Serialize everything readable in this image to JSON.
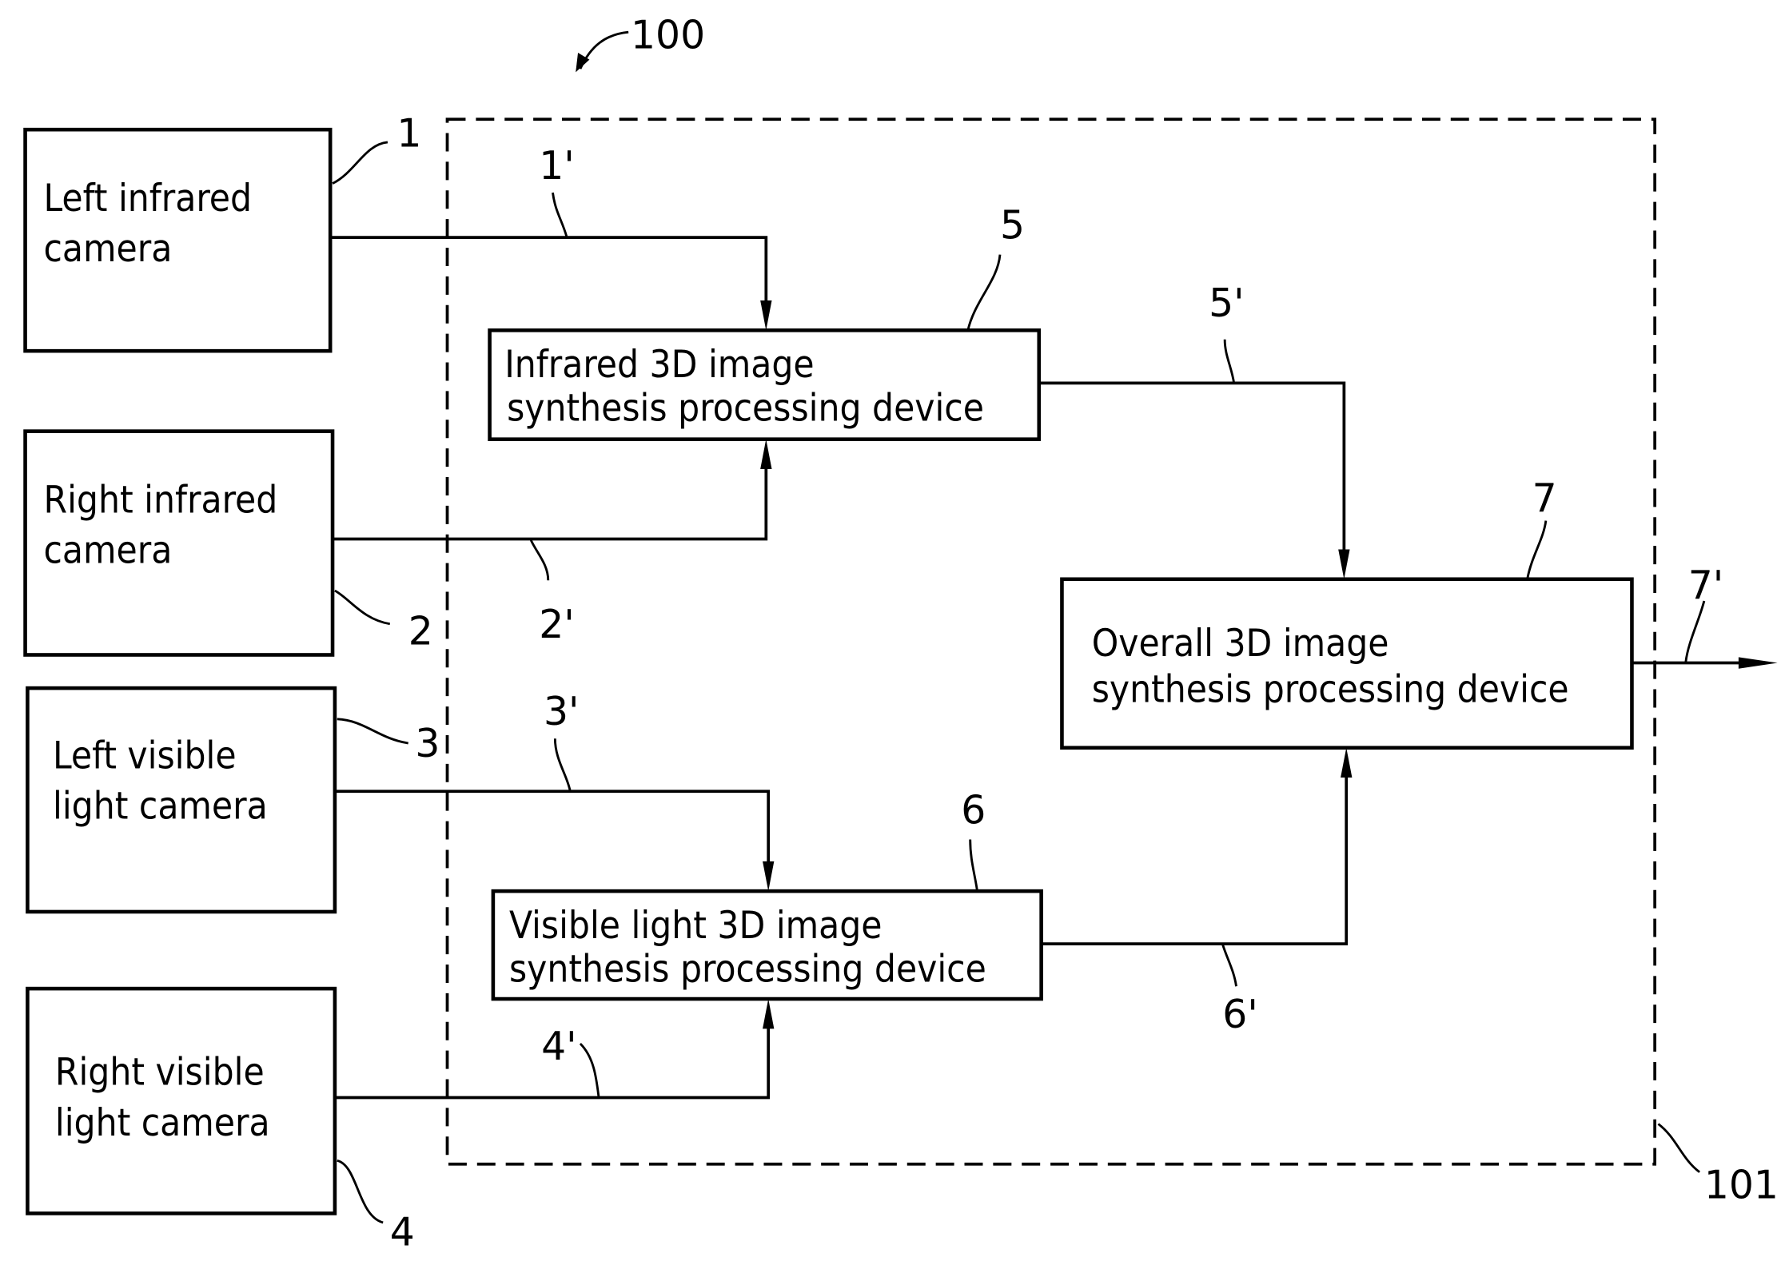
{
  "figure": {
    "reference": "100",
    "container_reference": "101"
  },
  "cameras": [
    {
      "id": "1",
      "line1": "Left infrared",
      "line2": "camera",
      "signal": "1'"
    },
    {
      "id": "2",
      "line1": "Right infrared",
      "line2": "camera",
      "signal": "2'"
    },
    {
      "id": "3",
      "line1": "Left visible",
      "line2": "light camera",
      "signal": "3'"
    },
    {
      "id": "4",
      "line1": "Right visible",
      "line2": "light camera",
      "signal": "4'"
    }
  ],
  "devices": [
    {
      "id": "5",
      "line1": "Infrared 3D image",
      "line2": "synthesis processing device",
      "signal": "5'"
    },
    {
      "id": "6",
      "line1": "Visible light 3D image",
      "line2": "synthesis processing device",
      "signal": "6'"
    },
    {
      "id": "7",
      "line1": "Overall 3D image",
      "line2": "synthesis processing device",
      "signal": "7'"
    }
  ],
  "colors": {
    "ink": "#000000",
    "paper": "#ffffff"
  }
}
